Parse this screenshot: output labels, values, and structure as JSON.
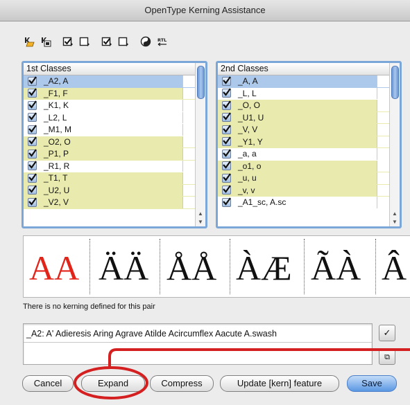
{
  "window": {
    "title": "OpenType Kerning Assistance"
  },
  "toolbar": {
    "icons": [
      "import-classes-icon",
      "export-classes-icon",
      "check-all-icon",
      "uncheck-all-icon",
      "check-all-icon",
      "uncheck-all-icon",
      "preview-icon",
      "rtl-icon"
    ]
  },
  "first_classes": {
    "header": "1st Classes",
    "items": [
      {
        "label": "_A2, A",
        "checked": true,
        "state": "selected"
      },
      {
        "label": "_F1, F",
        "checked": true,
        "state": "highlight"
      },
      {
        "label": "_K1, K",
        "checked": true,
        "state": "normal"
      },
      {
        "label": "_L2, L",
        "checked": true,
        "state": "normal"
      },
      {
        "label": "_M1, M",
        "checked": true,
        "state": "normal"
      },
      {
        "label": "_O2, O",
        "checked": true,
        "state": "highlight"
      },
      {
        "label": "_P1, P",
        "checked": true,
        "state": "highlight"
      },
      {
        "label": "_R1, R",
        "checked": true,
        "state": "normal"
      },
      {
        "label": "_T1, T",
        "checked": true,
        "state": "highlight"
      },
      {
        "label": "_U2, U",
        "checked": true,
        "state": "highlight"
      },
      {
        "label": "_V2, V",
        "checked": true,
        "state": "highlight"
      }
    ]
  },
  "second_classes": {
    "header": "2nd Classes",
    "items": [
      {
        "label": "_A, A",
        "checked": true,
        "state": "selected"
      },
      {
        "label": "_L, L",
        "checked": true,
        "state": "normal"
      },
      {
        "label": "_O, O",
        "checked": true,
        "state": "highlight"
      },
      {
        "label": "_U1, U",
        "checked": true,
        "state": "highlight"
      },
      {
        "label": "_V, V",
        "checked": true,
        "state": "highlight"
      },
      {
        "label": "_Y1, Y",
        "checked": true,
        "state": "highlight"
      },
      {
        "label": "_a, a",
        "checked": true,
        "state": "normal"
      },
      {
        "label": "_o1, o",
        "checked": true,
        "state": "highlight"
      },
      {
        "label": "_u, u",
        "checked": true,
        "state": "highlight"
      },
      {
        "label": "_v, v",
        "checked": true,
        "state": "highlight"
      },
      {
        "label": "_A1_sc, A.sc",
        "checked": true,
        "state": "normal"
      }
    ]
  },
  "preview": {
    "pairs": [
      "AA",
      "ÄÄ",
      "ÅÅ",
      "ÀÆ",
      "ÃÀ",
      "Â"
    ],
    "accent_color": "#e1251b"
  },
  "status_message": "There is no kerning defined for this pair",
  "class_definition": {
    "value": "_A2: A' Adieresis Aring Agrave Atilde Acircumflex Aacute A.swash"
  },
  "side_buttons": {
    "apply_glyph": "✓",
    "expand_field_glyph": "⧉"
  },
  "buttons": {
    "cancel": "Cancel",
    "expand": "Expand",
    "compress": "Compress",
    "update_kern": "Update [kern] feature",
    "save": "Save"
  },
  "annotation": {
    "color": "#d42020"
  }
}
